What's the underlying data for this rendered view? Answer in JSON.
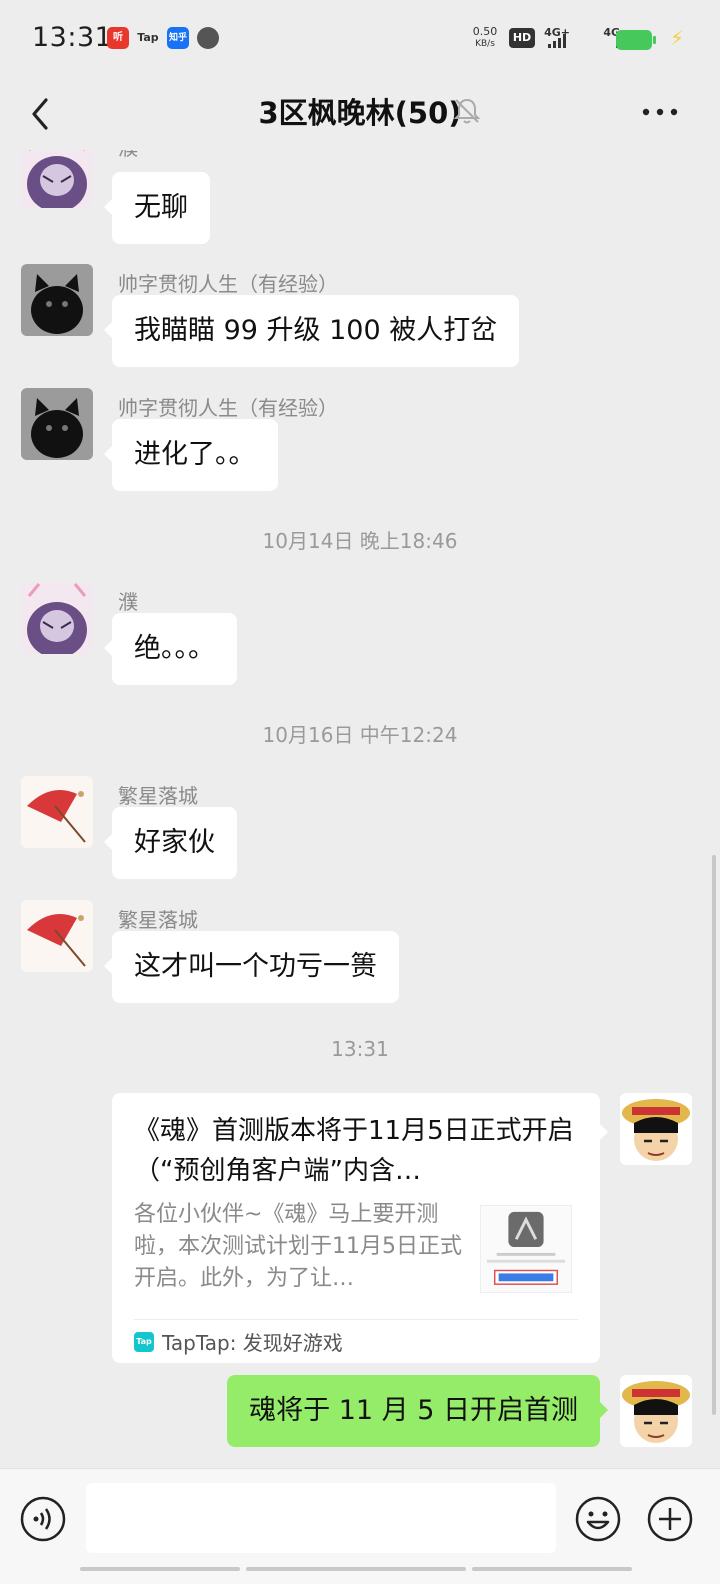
{
  "status_bar": {
    "time": "13:31",
    "net_speed_value": "0.50",
    "net_speed_unit": "KB/s",
    "hd_label": "HD",
    "sim1_label": "4G+",
    "sim2_label": "4G",
    "app_icons": [
      "ting-icon",
      "taptap-icon",
      "zhihu-icon",
      "misc-icon"
    ],
    "ting_label": "听",
    "taptap_label": "Tap",
    "zhihu_label": "知乎"
  },
  "header": {
    "title": "3区枫晚林(50)"
  },
  "messages": [
    {
      "sender": "濮",
      "text": "无聊"
    },
    {
      "sender": "帅字贯彻人生（有经验）",
      "text": "我瞄瞄 99 升级 100 被人打岔"
    },
    {
      "sender": "帅字贯彻人生（有经验）",
      "text": "进化了。。"
    },
    {
      "sender": "濮",
      "text": "绝。。。"
    },
    {
      "sender": "繁星落城",
      "text": "好家伙"
    },
    {
      "sender": "繁星落城",
      "text": "这才叫一个功亏一篑"
    }
  ],
  "timestamps": [
    "10月14日 晚上18:46",
    "10月16日 中午12:24",
    "13:31"
  ],
  "link_card": {
    "title": "《魂》首测版本将于11月5日正式开启（“预创角客户端”内含…",
    "description": "各位小伙伴~《魂》马上要开测啦，本次测试计划于11月5日正式开启。此外，为了让…",
    "source_logo": "Tap",
    "source": "TapTap: 发现好游戏"
  },
  "own_message": {
    "text": "魂将于 11 月 5 日开启首测"
  },
  "colors": {
    "background": "#ededed",
    "own_bubble": "#95ec69",
    "other_bubble": "#ffffff",
    "battery": "#46c95a"
  }
}
